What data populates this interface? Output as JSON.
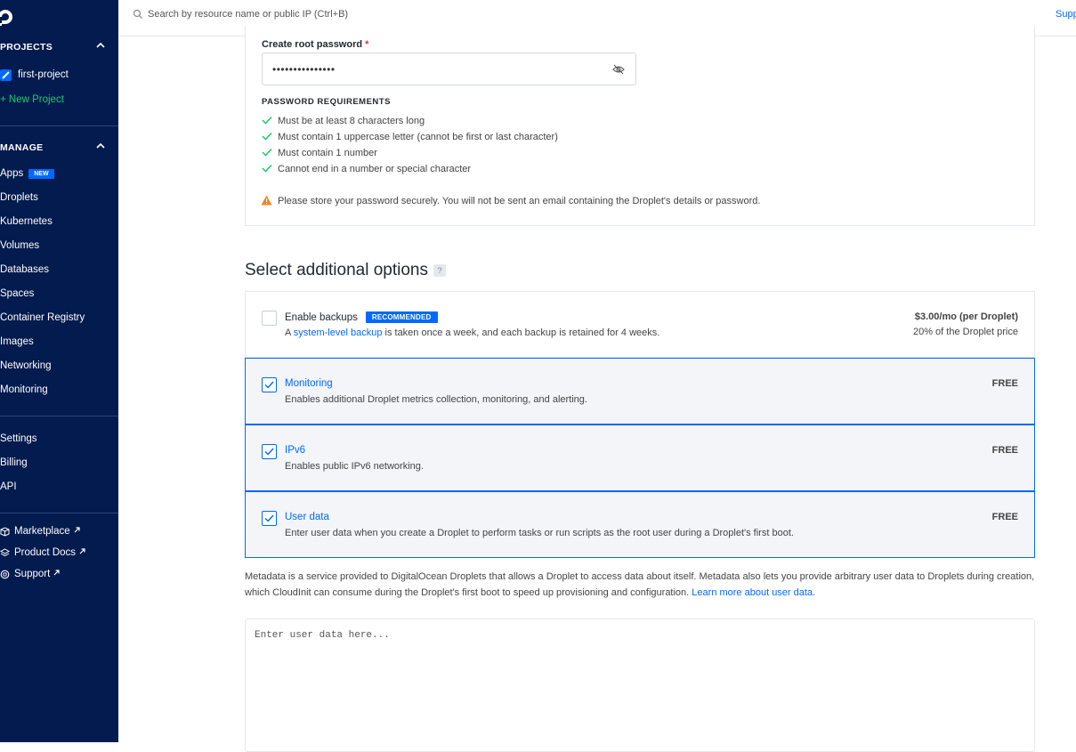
{
  "sidebar": {
    "projects_header": "PROJECTS",
    "project_name": "first-project",
    "new_project": "+ New Project",
    "manage_header": "MANAGE",
    "manage_items": [
      "Apps",
      "Droplets",
      "Kubernetes",
      "Volumes",
      "Databases",
      "Spaces",
      "Container Registry",
      "Images",
      "Networking",
      "Monitoring"
    ],
    "new_badge": "NEW",
    "account_items": [
      "Settings",
      "Billing",
      "API"
    ],
    "external_links": [
      "Marketplace",
      "Product Docs",
      "Support"
    ]
  },
  "topbar": {
    "search_placeholder": "Search by resource name or public IP (Ctrl+B)",
    "support_label": "Supp"
  },
  "password": {
    "label": "Create root password",
    "required_mark": "*",
    "value": "•••••••••••••••",
    "requirements_title": "PASSWORD REQUIREMENTS",
    "requirements": [
      "Must be at least 8 characters long",
      "Must contain 1 uppercase letter (cannot be first or last character)",
      "Must contain 1 number",
      "Cannot end in a number or special character"
    ],
    "warning": "Please store your password securely. You will not be sent an email containing the Droplet's details or password."
  },
  "options": {
    "title": "Select additional options",
    "help": "?",
    "backups": {
      "title": "Enable backups",
      "badge": "RECOMMENDED",
      "desc_prefix": "A ",
      "desc_link": "system-level backup",
      "desc_suffix": " is taken once a week, and each backup is retained for 4 weeks.",
      "price": "$3.00/mo (per Droplet)",
      "price_note": "20% of the Droplet price",
      "checked": false
    },
    "monitoring": {
      "title": "Monitoring",
      "desc": "Enables additional Droplet metrics collection, monitoring, and alerting.",
      "price": "FREE",
      "checked": true
    },
    "ipv6": {
      "title": "IPv6",
      "desc": "Enables public IPv6 networking.",
      "price": "FREE",
      "checked": true
    },
    "user_data": {
      "title": "User data",
      "desc": "Enter user data when you create a Droplet to perform tasks or run scripts as the root user during a Droplet's first boot.",
      "price": "FREE",
      "checked": true
    }
  },
  "metadata": {
    "text": "Metadata is a service provided to DigitalOcean Droplets that allows a Droplet to access data about itself. Metadata also lets you provide arbitrary user data to Droplets during creation, which CloudInit can consume during the Droplet's first boot to speed up provisioning and configuration. ",
    "link": "Learn more about user data",
    "end": "."
  },
  "user_data_input": {
    "placeholder": "Enter user data here...",
    "value": ""
  },
  "colors": {
    "sidebar_bg": "#031b4e",
    "accent": "#0069ff",
    "check_green": "#15cd72",
    "warning_orange": "#f5841f"
  }
}
